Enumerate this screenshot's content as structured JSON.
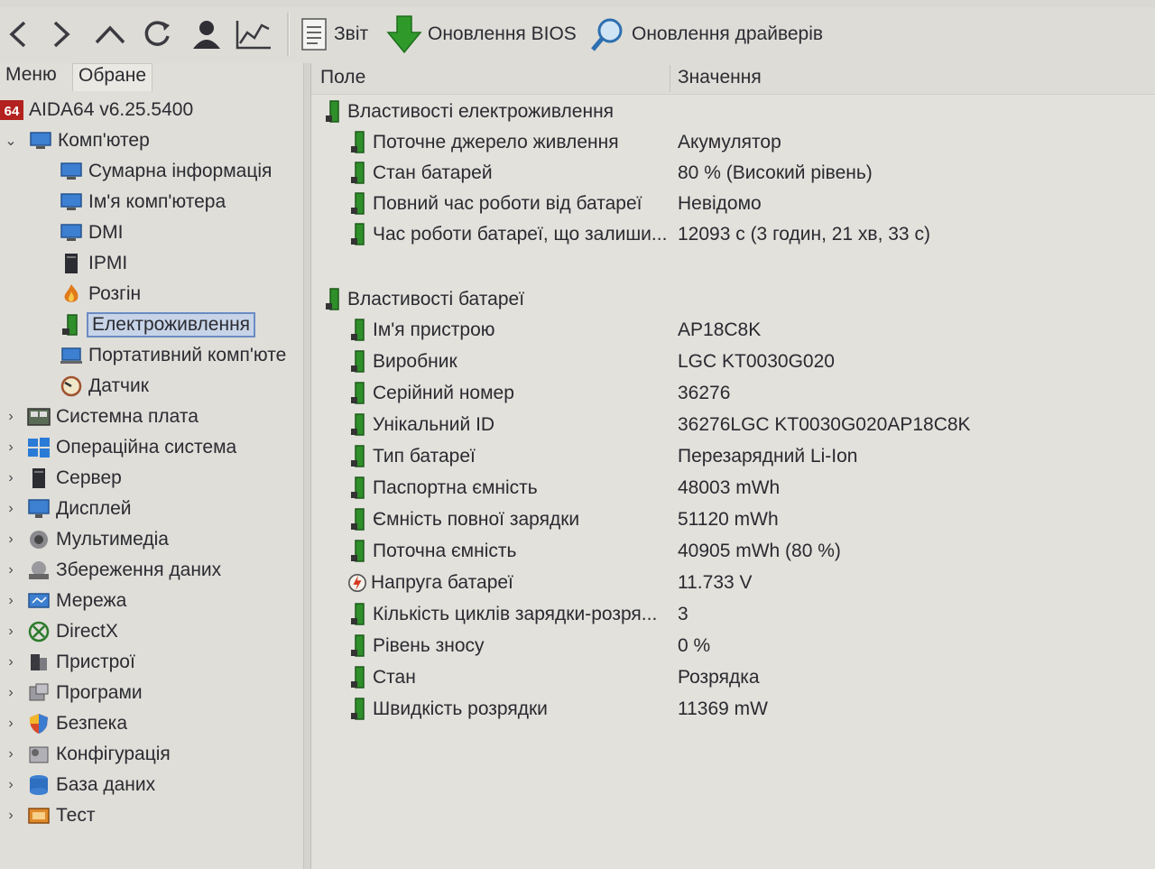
{
  "toolbar": {
    "report_label": "Звіт",
    "bios_label": "Оновлення BIOS",
    "drivers_label": "Оновлення драйверів"
  },
  "left": {
    "tabs": [
      "Меню",
      "Обране"
    ],
    "app_title": "AIDA64 v6.25.5400",
    "app_icon_text": "64",
    "computer": "Комп'ютер",
    "computer_children": [
      "Сумарна інформація",
      "Ім'я комп'ютера",
      "DMI",
      "IPMI",
      "Розгін",
      "Електроживлення",
      "Портативний комп'юте",
      "Датчик"
    ],
    "categories": [
      "Системна плата",
      "Операційна система",
      "Сервер",
      "Дисплей",
      "Мультимедіа",
      "Збереження даних",
      "Мережа",
      "DirectX",
      "Пристрої",
      "Програми",
      "Безпека",
      "Конфігурація",
      "База даних",
      "Тест"
    ]
  },
  "right": {
    "col_field": "Поле",
    "col_value": "Значення",
    "group1": "Властивості електроживлення",
    "group1_rows": [
      {
        "field": "Поточне джерело живлення",
        "value": "Акумулятор"
      },
      {
        "field": "Стан батарей",
        "value": "80 % (Високий рівень)"
      },
      {
        "field": "Повний час роботи від батареї",
        "value": "Невідомо"
      },
      {
        "field": "Час роботи батареї, що залиши...",
        "value": "12093 с (3 годин, 21 хв, 33 с)"
      }
    ],
    "group2": "Властивості батареї",
    "group2_rows": [
      {
        "field": "Ім'я пристрою",
        "value": "AP18C8K"
      },
      {
        "field": "Виробник",
        "value": "LGC KT0030G020"
      },
      {
        "field": "Серійний номер",
        "value": "36276"
      },
      {
        "field": "Унікальний ID",
        "value": "36276LGC KT0030G020AP18C8K"
      },
      {
        "field": "Тип батареї",
        "value": "Перезарядний Li-Ion"
      },
      {
        "field": "Паспортна ємність",
        "value": "48003 mWh"
      },
      {
        "field": "Ємність повної зарядки",
        "value": "51120 mWh"
      },
      {
        "field": "Поточна ємність",
        "value": "40905 mWh  (80 %)"
      },
      {
        "field": "Напруга батареї",
        "value": "11.733 V"
      },
      {
        "field": "Кількість циклів зарядки-розря...",
        "value": "3"
      },
      {
        "field": "Рівень зносу",
        "value": "0 %"
      },
      {
        "field": "Стан",
        "value": "Розрядка"
      },
      {
        "field": "Швидкість розрядки",
        "value": "11369 mW"
      }
    ]
  }
}
